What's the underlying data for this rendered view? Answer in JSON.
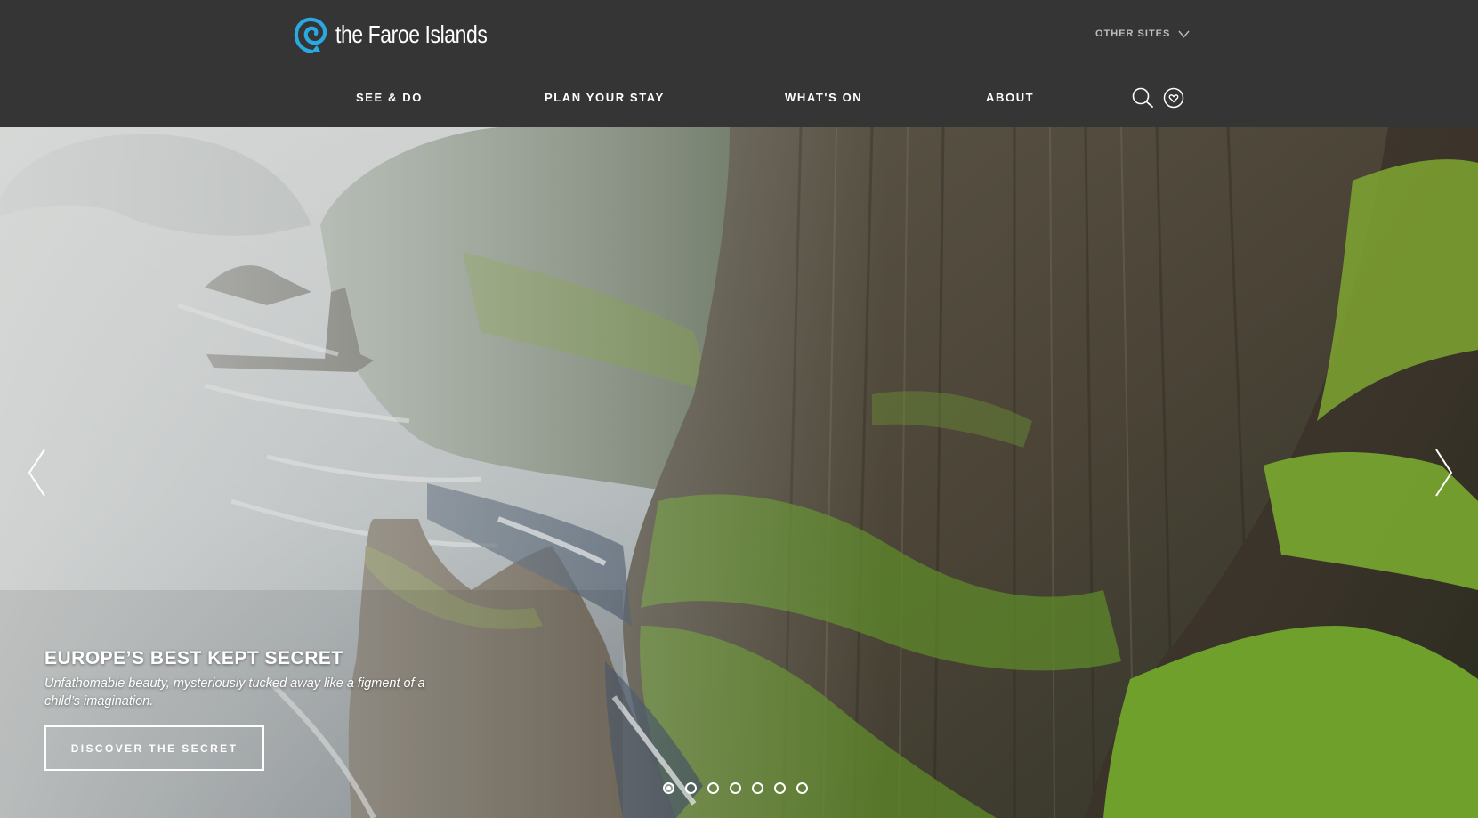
{
  "brand": {
    "logo_text": "the Faroe Islands",
    "accent_color": "#2aa8e0",
    "logo_icon": "spiral-logo-icon"
  },
  "header": {
    "other_sites_label": "OTHER SITES",
    "nav": [
      {
        "label": "SEE & DO"
      },
      {
        "label": "PLAN YOUR STAY"
      },
      {
        "label": "WHAT'S ON"
      },
      {
        "label": "ABOUT"
      }
    ],
    "icons": [
      "search-icon",
      "heart-icon"
    ]
  },
  "hero": {
    "title": "EUROPE’S BEST KEPT SECRET",
    "subtitle": "Unfathomable beauty, mysteriously tucked away like a figment of a child’s imagination.",
    "cta_label": "DISCOVER THE SECRET",
    "slide_count": 7,
    "active_slide": 1,
    "icons": [
      "chevron-left-icon",
      "chevron-right-icon"
    ]
  }
}
